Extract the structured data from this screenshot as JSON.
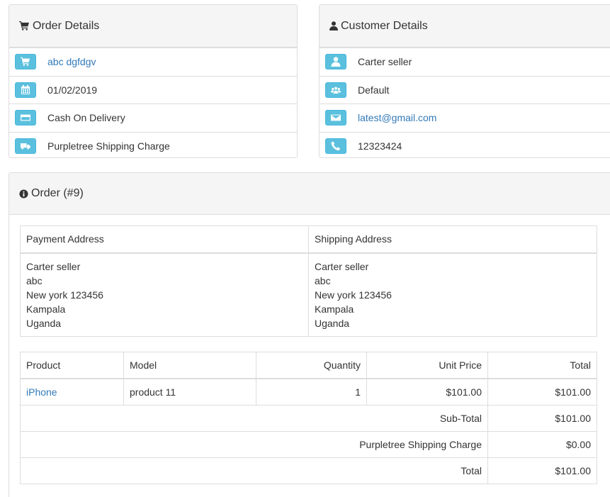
{
  "order_details": {
    "title": "Order Details",
    "icon": "shopping-cart-icon",
    "rows": [
      {
        "icon": "shopping-cart-icon",
        "text": "abc dgfdgv",
        "is_link": true
      },
      {
        "icon": "calendar-icon",
        "text": "01/02/2019",
        "is_link": false
      },
      {
        "icon": "credit-card-icon",
        "text": "Cash On Delivery",
        "is_link": false
      },
      {
        "icon": "truck-icon",
        "text": "Purpletree Shipping Charge",
        "is_link": false
      }
    ]
  },
  "customer_details": {
    "title": "Customer Details",
    "icon": "user-icon",
    "rows": [
      {
        "icon": "user-icon",
        "text": "Carter seller",
        "is_link": false
      },
      {
        "icon": "group-icon",
        "text": "Default",
        "is_link": false
      },
      {
        "icon": "envelope-icon",
        "text": "latest@gmail.com",
        "is_link": true
      },
      {
        "icon": "phone-icon",
        "text": "12323424",
        "is_link": false
      }
    ]
  },
  "order": {
    "title": "Order (#9)",
    "icon": "info-circle-icon",
    "address": {
      "payment_header": "Payment Address",
      "shipping_header": "Shipping Address",
      "payment_lines": [
        "Carter seller",
        "abc",
        "New york 123456",
        "Kampala",
        "Uganda"
      ],
      "shipping_lines": [
        "Carter seller",
        "abc",
        "New york 123456",
        "Kampala",
        "Uganda"
      ]
    },
    "products": {
      "headers": {
        "product": "Product",
        "model": "Model",
        "quantity": "Quantity",
        "unit_price": "Unit Price",
        "total": "Total"
      },
      "items": [
        {
          "product": "iPhone",
          "model": "product 11",
          "quantity": "1",
          "unit_price": "$101.00",
          "total": "$101.00"
        }
      ],
      "totals": [
        {
          "label": "Sub-Total",
          "value": "$101.00"
        },
        {
          "label": "Purpletree Shipping Charge",
          "value": "$0.00"
        },
        {
          "label": "Total",
          "value": "$101.00"
        }
      ]
    }
  },
  "colors": {
    "accent_button": "#5bc0de",
    "link": "#337ab7",
    "panel_heading_bg": "#f5f5f5",
    "border": "#dddddd"
  }
}
